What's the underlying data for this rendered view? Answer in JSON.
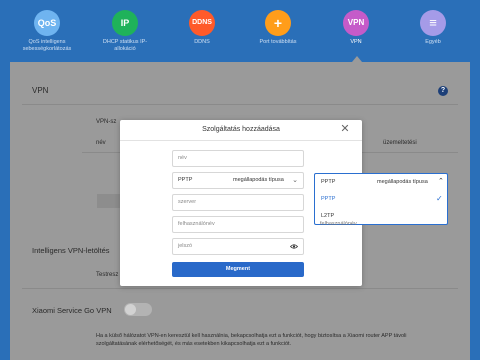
{
  "nav": {
    "items": [
      {
        "icon": "QoS",
        "label_line1": "QoS intelligens",
        "label_line2": "sebességkorlátozás",
        "color": "#6fb4f0"
      },
      {
        "icon": "IP",
        "label_line1": "DHCP statikus IP-allokáció",
        "label_line2": "",
        "color": "#1fb25a"
      },
      {
        "icon": "DDNS",
        "label_line1": "DDNS",
        "label_line2": "",
        "color": "#ff5a2a"
      },
      {
        "icon": "+",
        "label_line1": "Port továbbítás",
        "label_line2": "",
        "color": "#ff9d1a"
      },
      {
        "icon": "VPN",
        "label_line1": "VPN",
        "label_line2": "",
        "color": "#c55bc9"
      },
      {
        "icon": "≡",
        "label_line1": "Egyéb",
        "label_line2": "",
        "color": "#a59be8"
      }
    ]
  },
  "page": {
    "vpn_title": "VPN",
    "vpn_settings_partial": "VPN-sz",
    "col_name_partial": "név",
    "col_status_partial": "üzemeltetési",
    "smart_vpn_title": "Intelligens VPN-letöltés",
    "test_partial": "Testresz",
    "service_go_title": "Xiaomi Service Go VPN",
    "service_go_desc_line1": "Ha a külső hálózatot VPN-en keresztül kell használnia, bekapcsolhatja ezt a funkciót, hogy biztosítsa a Xiaomi router APP távoli",
    "service_go_desc_line2": "szolgáltatásának elérhetőségét, és más esetekben kikapcsolhatja ezt a funkciót."
  },
  "modal": {
    "title": "Szolgáltatás hozzáadása",
    "name_placeholder": "név",
    "protocol_value": "PPTP",
    "protocol_label": "megállapodás típusa",
    "server_placeholder": "szerver",
    "username_placeholder": "felhasználónév",
    "password_placeholder": "jelszó",
    "save_label": "Megment"
  },
  "dropdown": {
    "selected": "PPTP",
    "label": "megállapodás típusa",
    "options": [
      "PPTP",
      "L2TP"
    ],
    "below_partial": "felhasználónév"
  },
  "colors": {
    "brand_blue": "#2a6fb8",
    "accent": "#2969c9"
  }
}
